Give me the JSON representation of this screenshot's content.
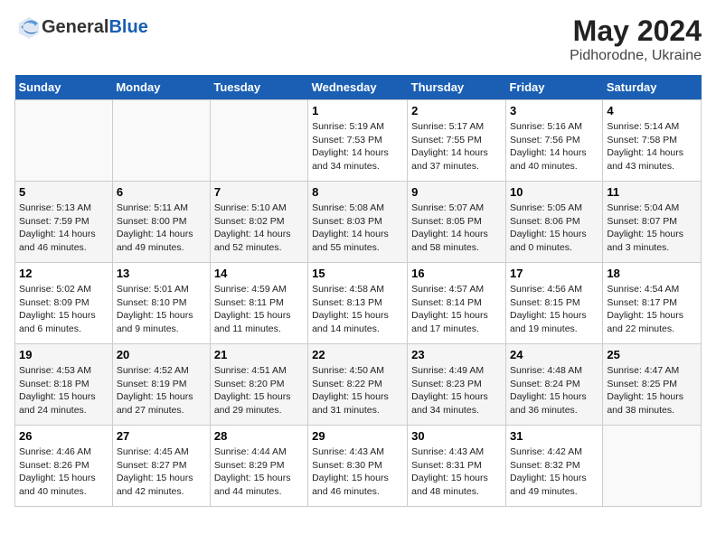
{
  "header": {
    "logo_general": "General",
    "logo_blue": "Blue",
    "month_year": "May 2024",
    "location": "Pidhorodne, Ukraine"
  },
  "weekdays": [
    "Sunday",
    "Monday",
    "Tuesday",
    "Wednesday",
    "Thursday",
    "Friday",
    "Saturday"
  ],
  "weeks": [
    [
      {
        "day": "",
        "info": ""
      },
      {
        "day": "",
        "info": ""
      },
      {
        "day": "",
        "info": ""
      },
      {
        "day": "1",
        "info": "Sunrise: 5:19 AM\nSunset: 7:53 PM\nDaylight: 14 hours\nand 34 minutes."
      },
      {
        "day": "2",
        "info": "Sunrise: 5:17 AM\nSunset: 7:55 PM\nDaylight: 14 hours\nand 37 minutes."
      },
      {
        "day": "3",
        "info": "Sunrise: 5:16 AM\nSunset: 7:56 PM\nDaylight: 14 hours\nand 40 minutes."
      },
      {
        "day": "4",
        "info": "Sunrise: 5:14 AM\nSunset: 7:58 PM\nDaylight: 14 hours\nand 43 minutes."
      }
    ],
    [
      {
        "day": "5",
        "info": "Sunrise: 5:13 AM\nSunset: 7:59 PM\nDaylight: 14 hours\nand 46 minutes."
      },
      {
        "day": "6",
        "info": "Sunrise: 5:11 AM\nSunset: 8:00 PM\nDaylight: 14 hours\nand 49 minutes."
      },
      {
        "day": "7",
        "info": "Sunrise: 5:10 AM\nSunset: 8:02 PM\nDaylight: 14 hours\nand 52 minutes."
      },
      {
        "day": "8",
        "info": "Sunrise: 5:08 AM\nSunset: 8:03 PM\nDaylight: 14 hours\nand 55 minutes."
      },
      {
        "day": "9",
        "info": "Sunrise: 5:07 AM\nSunset: 8:05 PM\nDaylight: 14 hours\nand 58 minutes."
      },
      {
        "day": "10",
        "info": "Sunrise: 5:05 AM\nSunset: 8:06 PM\nDaylight: 15 hours\nand 0 minutes."
      },
      {
        "day": "11",
        "info": "Sunrise: 5:04 AM\nSunset: 8:07 PM\nDaylight: 15 hours\nand 3 minutes."
      }
    ],
    [
      {
        "day": "12",
        "info": "Sunrise: 5:02 AM\nSunset: 8:09 PM\nDaylight: 15 hours\nand 6 minutes."
      },
      {
        "day": "13",
        "info": "Sunrise: 5:01 AM\nSunset: 8:10 PM\nDaylight: 15 hours\nand 9 minutes."
      },
      {
        "day": "14",
        "info": "Sunrise: 4:59 AM\nSunset: 8:11 PM\nDaylight: 15 hours\nand 11 minutes."
      },
      {
        "day": "15",
        "info": "Sunrise: 4:58 AM\nSunset: 8:13 PM\nDaylight: 15 hours\nand 14 minutes."
      },
      {
        "day": "16",
        "info": "Sunrise: 4:57 AM\nSunset: 8:14 PM\nDaylight: 15 hours\nand 17 minutes."
      },
      {
        "day": "17",
        "info": "Sunrise: 4:56 AM\nSunset: 8:15 PM\nDaylight: 15 hours\nand 19 minutes."
      },
      {
        "day": "18",
        "info": "Sunrise: 4:54 AM\nSunset: 8:17 PM\nDaylight: 15 hours\nand 22 minutes."
      }
    ],
    [
      {
        "day": "19",
        "info": "Sunrise: 4:53 AM\nSunset: 8:18 PM\nDaylight: 15 hours\nand 24 minutes."
      },
      {
        "day": "20",
        "info": "Sunrise: 4:52 AM\nSunset: 8:19 PM\nDaylight: 15 hours\nand 27 minutes."
      },
      {
        "day": "21",
        "info": "Sunrise: 4:51 AM\nSunset: 8:20 PM\nDaylight: 15 hours\nand 29 minutes."
      },
      {
        "day": "22",
        "info": "Sunrise: 4:50 AM\nSunset: 8:22 PM\nDaylight: 15 hours\nand 31 minutes."
      },
      {
        "day": "23",
        "info": "Sunrise: 4:49 AM\nSunset: 8:23 PM\nDaylight: 15 hours\nand 34 minutes."
      },
      {
        "day": "24",
        "info": "Sunrise: 4:48 AM\nSunset: 8:24 PM\nDaylight: 15 hours\nand 36 minutes."
      },
      {
        "day": "25",
        "info": "Sunrise: 4:47 AM\nSunset: 8:25 PM\nDaylight: 15 hours\nand 38 minutes."
      }
    ],
    [
      {
        "day": "26",
        "info": "Sunrise: 4:46 AM\nSunset: 8:26 PM\nDaylight: 15 hours\nand 40 minutes."
      },
      {
        "day": "27",
        "info": "Sunrise: 4:45 AM\nSunset: 8:27 PM\nDaylight: 15 hours\nand 42 minutes."
      },
      {
        "day": "28",
        "info": "Sunrise: 4:44 AM\nSunset: 8:29 PM\nDaylight: 15 hours\nand 44 minutes."
      },
      {
        "day": "29",
        "info": "Sunrise: 4:43 AM\nSunset: 8:30 PM\nDaylight: 15 hours\nand 46 minutes."
      },
      {
        "day": "30",
        "info": "Sunrise: 4:43 AM\nSunset: 8:31 PM\nDaylight: 15 hours\nand 48 minutes."
      },
      {
        "day": "31",
        "info": "Sunrise: 4:42 AM\nSunset: 8:32 PM\nDaylight: 15 hours\nand 49 minutes."
      },
      {
        "day": "",
        "info": ""
      }
    ]
  ]
}
